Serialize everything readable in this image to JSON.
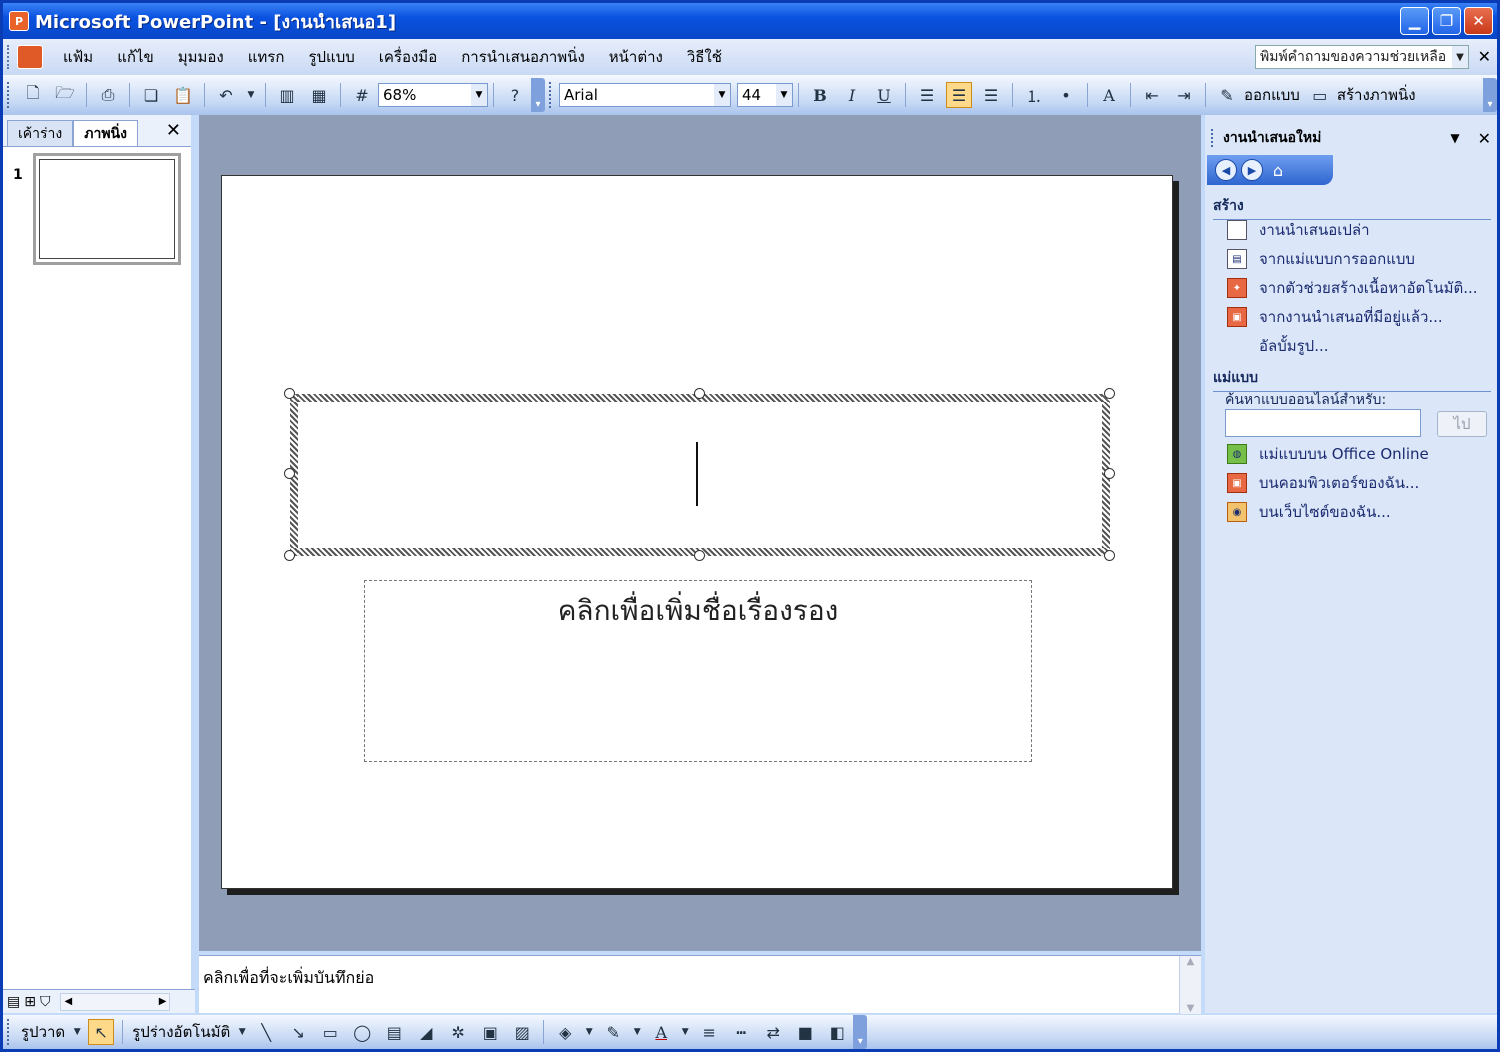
{
  "window": {
    "title": "Microsoft PowerPoint - [งานนำเสนอ1]",
    "app_icon": "powerpoint-icon",
    "controls": [
      "minimize-icon",
      "restore-icon",
      "close-icon"
    ]
  },
  "menu": {
    "items": [
      "แฟ้ม",
      "แก้ไข",
      "มุมมอง",
      "แทรก",
      "รูปแบบ",
      "เครื่องมือ",
      "การนำเสนอภาพนิ่ง",
      "หน้าต่าง",
      "วิธีใช้"
    ],
    "help_box": "พิมพ์คำถามของความช่วยเหลือ"
  },
  "toolbar": {
    "zoom": "68%",
    "font": "Arial",
    "font_size": "44",
    "bold": "B",
    "italic": "I",
    "underline": "U",
    "grow_font": "A",
    "design_label": "ออกแบบ",
    "new_slide_label": "สร้างภาพนิ่ง"
  },
  "left_pane": {
    "tabs": [
      "เค้าร่าง",
      "ภาพนิ่ง"
    ],
    "slide_number": "1"
  },
  "slide": {
    "subtitle_placeholder": "คลิกเพื่อเพิ่มชื่อเรื่องรอง"
  },
  "notes": {
    "placeholder": "คลิกเพื่อที่จะเพิ่มบันทึกย่อ"
  },
  "task_pane": {
    "title": "งานนำเสนอใหม่",
    "create_heading": "สร้าง",
    "create_items": [
      "งานนำเสนอเปล่า",
      "จากแม่แบบการออกแบบ",
      "จากตัวช่วยสร้างเนื้อหาอัตโนมัติ...",
      "จากงานนำเสนอที่มีอยู่แล้ว...",
      "อัลบั้มรูป..."
    ],
    "templates_heading": "แม่แบบ",
    "search_label": "ค้นหาแบบออนไลน์สำหรับ:",
    "go_button": "ไป",
    "template_items": [
      "แม่แบบบน Office Online",
      "บนคอมพิวเตอร์ของฉัน...",
      "บนเว็บไซต์ของฉัน..."
    ]
  },
  "drawing_toolbar": {
    "draw_label": "รูปวาด",
    "autoshapes_label": "รูปร่างอัตโนมัติ",
    "text_color": "A"
  }
}
